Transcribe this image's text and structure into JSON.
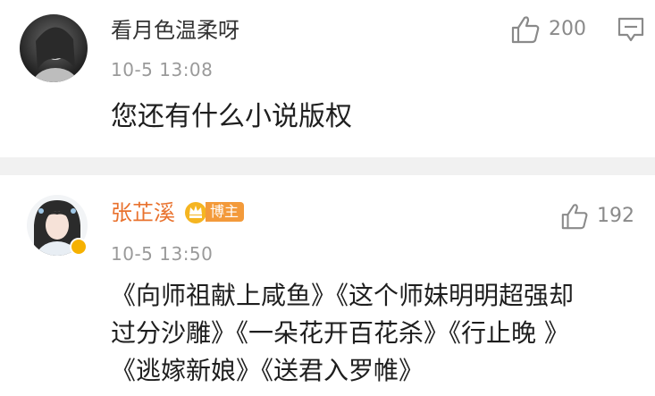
{
  "comments": [
    {
      "username": "看月色温柔呀",
      "timestamp": "10-5 13:08",
      "text": "您还有什么小说版权",
      "likes": "200",
      "icons": [
        "thumbs-up-icon",
        "reply-icon"
      ]
    },
    {
      "username": "张芷溪",
      "badge": "博主",
      "timestamp": "10-5 13:50",
      "text_lines": [
        "《向师祖献上咸鱼》《这个师妹明明超强却",
        "过分沙雕》《一朵花开百花杀》《行止晚 》",
        "《逃嫁新娘》《送君入罗帷》"
      ],
      "likes": "192",
      "icons": [
        "thumbs-up-icon",
        "verified-icon",
        "crown-icon"
      ]
    }
  ],
  "colors": {
    "creator_name": "#e9722e",
    "badge": "#f39a3a",
    "timestamp": "#9a9a9a",
    "divider": "#f1f1f1"
  }
}
